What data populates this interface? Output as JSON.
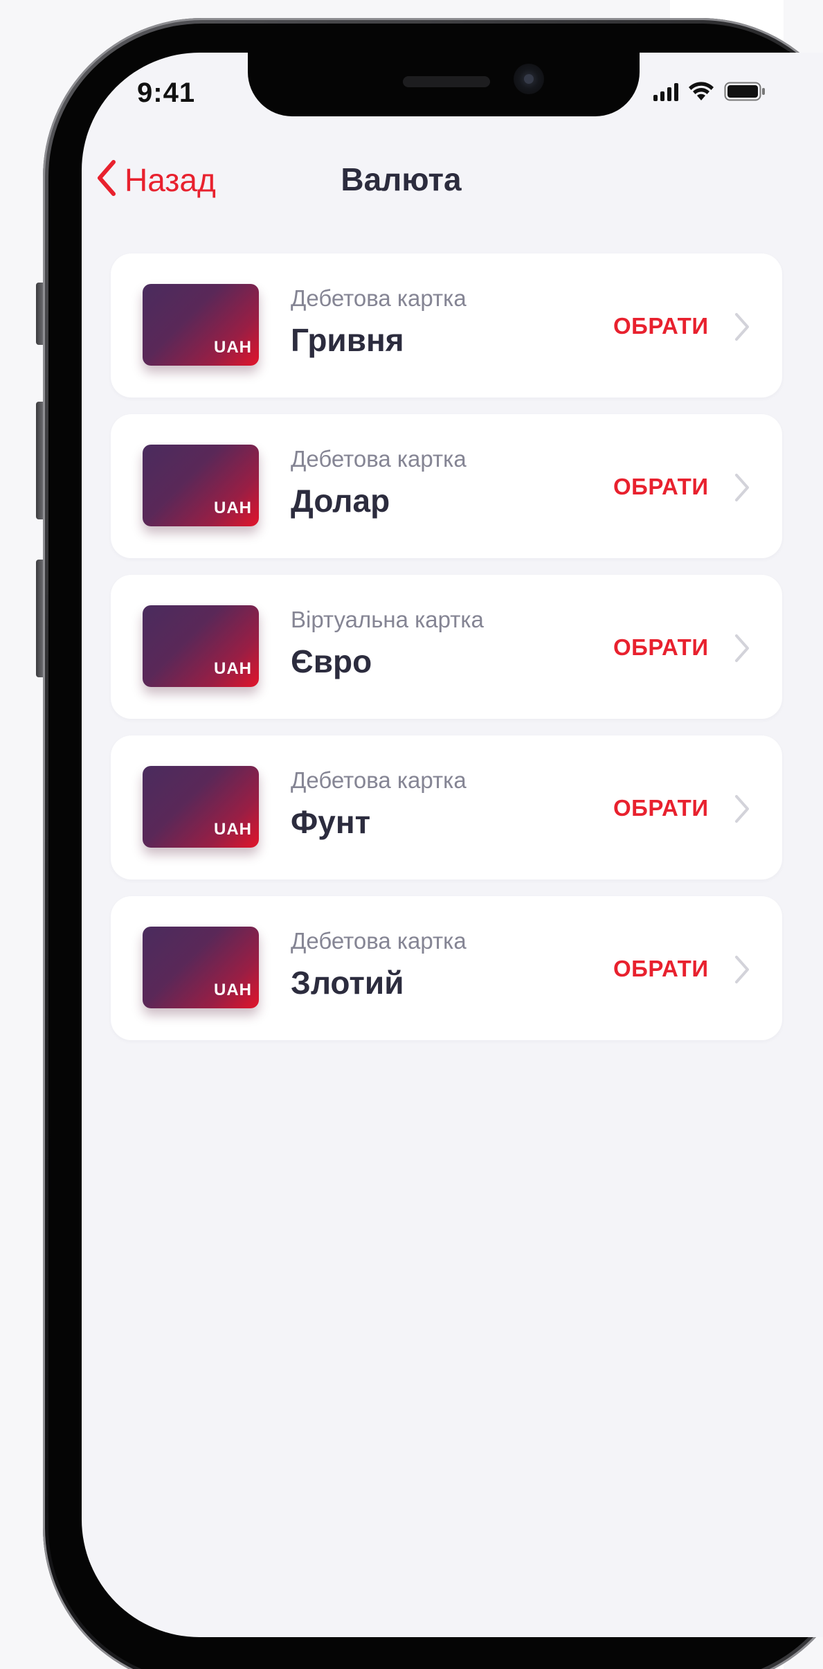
{
  "status_bar": {
    "time": "9:41",
    "icons": [
      "signal-icon",
      "wifi-icon",
      "battery-icon"
    ]
  },
  "nav": {
    "back_label": "Назад",
    "title": "Валюта"
  },
  "colors": {
    "accent": "#e8212e",
    "text_primary": "#2c2c3e",
    "text_secondary": "#858594",
    "screen_bg": "#f4f4f8",
    "card_gradient_start": "#4a2c5e",
    "card_gradient_end": "#e2142a"
  },
  "currencies": [
    {
      "card_currency": "UAH",
      "subtitle": "Дебетова картка",
      "title": "Гривня",
      "action": "ОБРАТИ"
    },
    {
      "card_currency": "UAH",
      "subtitle": "Дебетова картка",
      "title": "Долар",
      "action": "ОБРАТИ"
    },
    {
      "card_currency": "UAH",
      "subtitle": "Віртуальна картка",
      "title": "Євро",
      "action": "ОБРАТИ"
    },
    {
      "card_currency": "UAH",
      "subtitle": "Дебетова картка",
      "title": "Фунт",
      "action": "ОБРАТИ"
    },
    {
      "card_currency": "UAH",
      "subtitle": "Дебетова картка",
      "title": "Злотий",
      "action": "ОБРАТИ"
    }
  ]
}
